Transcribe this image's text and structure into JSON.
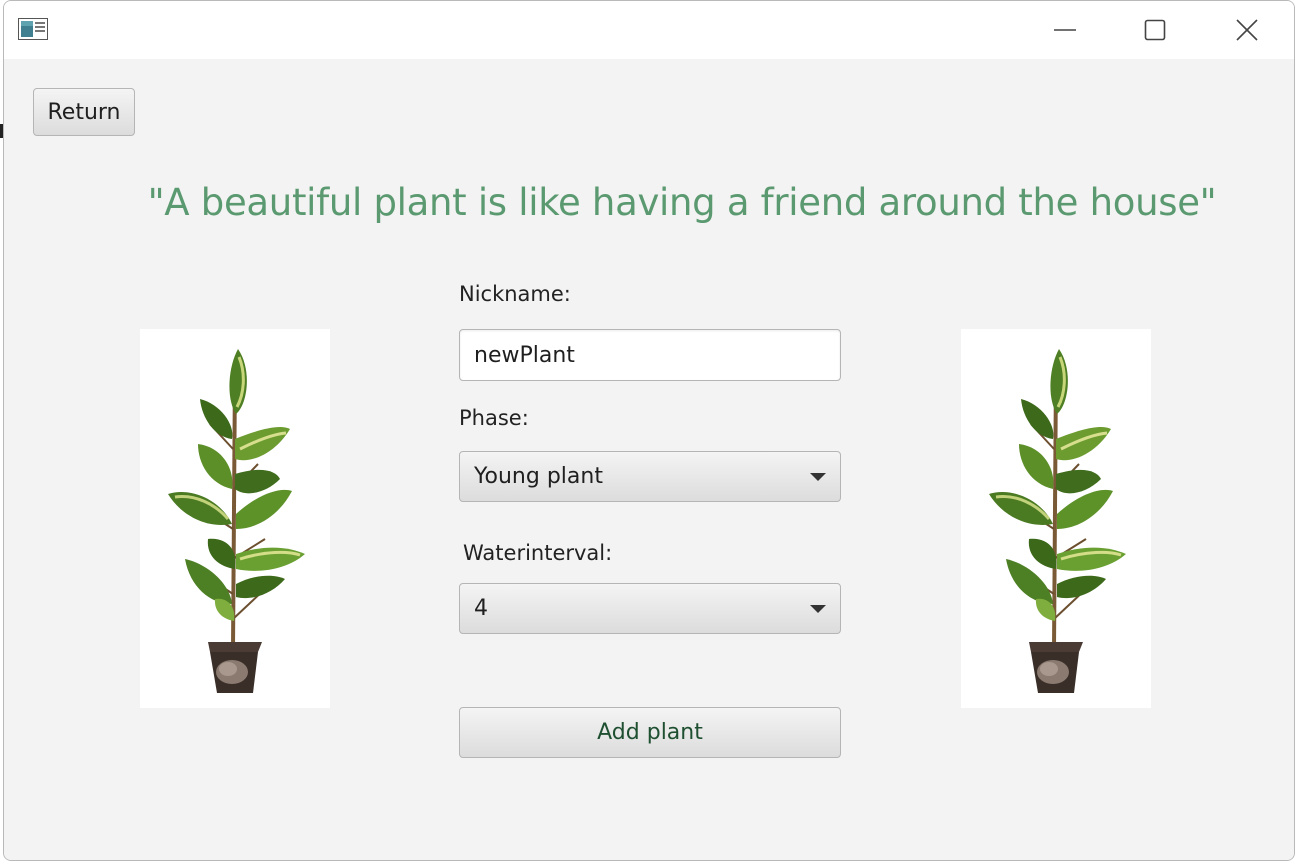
{
  "window": {
    "title": "",
    "controls": {
      "minimize": "minimize-icon",
      "maximize": "maximize-icon",
      "close": "close-icon"
    }
  },
  "toolbar": {
    "return_label": "Return"
  },
  "quote": "\"A beautiful plant is like having a friend around the house\"",
  "form": {
    "nickname_label": "Nickname:",
    "nickname_value": "newPlant",
    "phase_label": "Phase:",
    "phase_selected": "Young plant",
    "waterinterval_label": "Waterinterval:",
    "waterinterval_selected": "4",
    "add_label": "Add plant"
  },
  "colors": {
    "quote_text": "#5b9a70",
    "add_text": "#1f4f31",
    "background": "#f3f3f3"
  },
  "images": {
    "left": "potted-plant-image",
    "right": "potted-plant-image"
  }
}
